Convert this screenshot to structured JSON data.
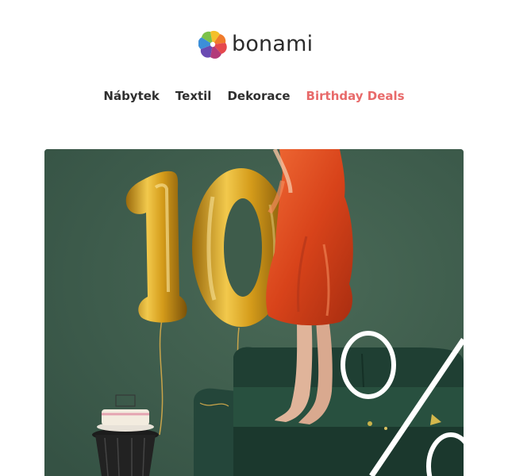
{
  "brand": {
    "name": "bonami",
    "logo_icon": "flower-logo-icon"
  },
  "nav": {
    "items": [
      {
        "label": "Nábytek"
      },
      {
        "label": "Textil"
      },
      {
        "label": "Dekorace"
      },
      {
        "label": "Birthday Deals",
        "color": "#e86a6a"
      }
    ]
  },
  "hero": {
    "balloon_text": "10",
    "background_color": "#3f5c4b"
  },
  "colors": {
    "text": "#2f2f2f",
    "accent": "#e86a6a",
    "hero_green": "#3f5c4b",
    "sofa_green": "#1f3f33",
    "balloon_gold": "#d8a31c",
    "dress_red": "#e24a1b"
  }
}
